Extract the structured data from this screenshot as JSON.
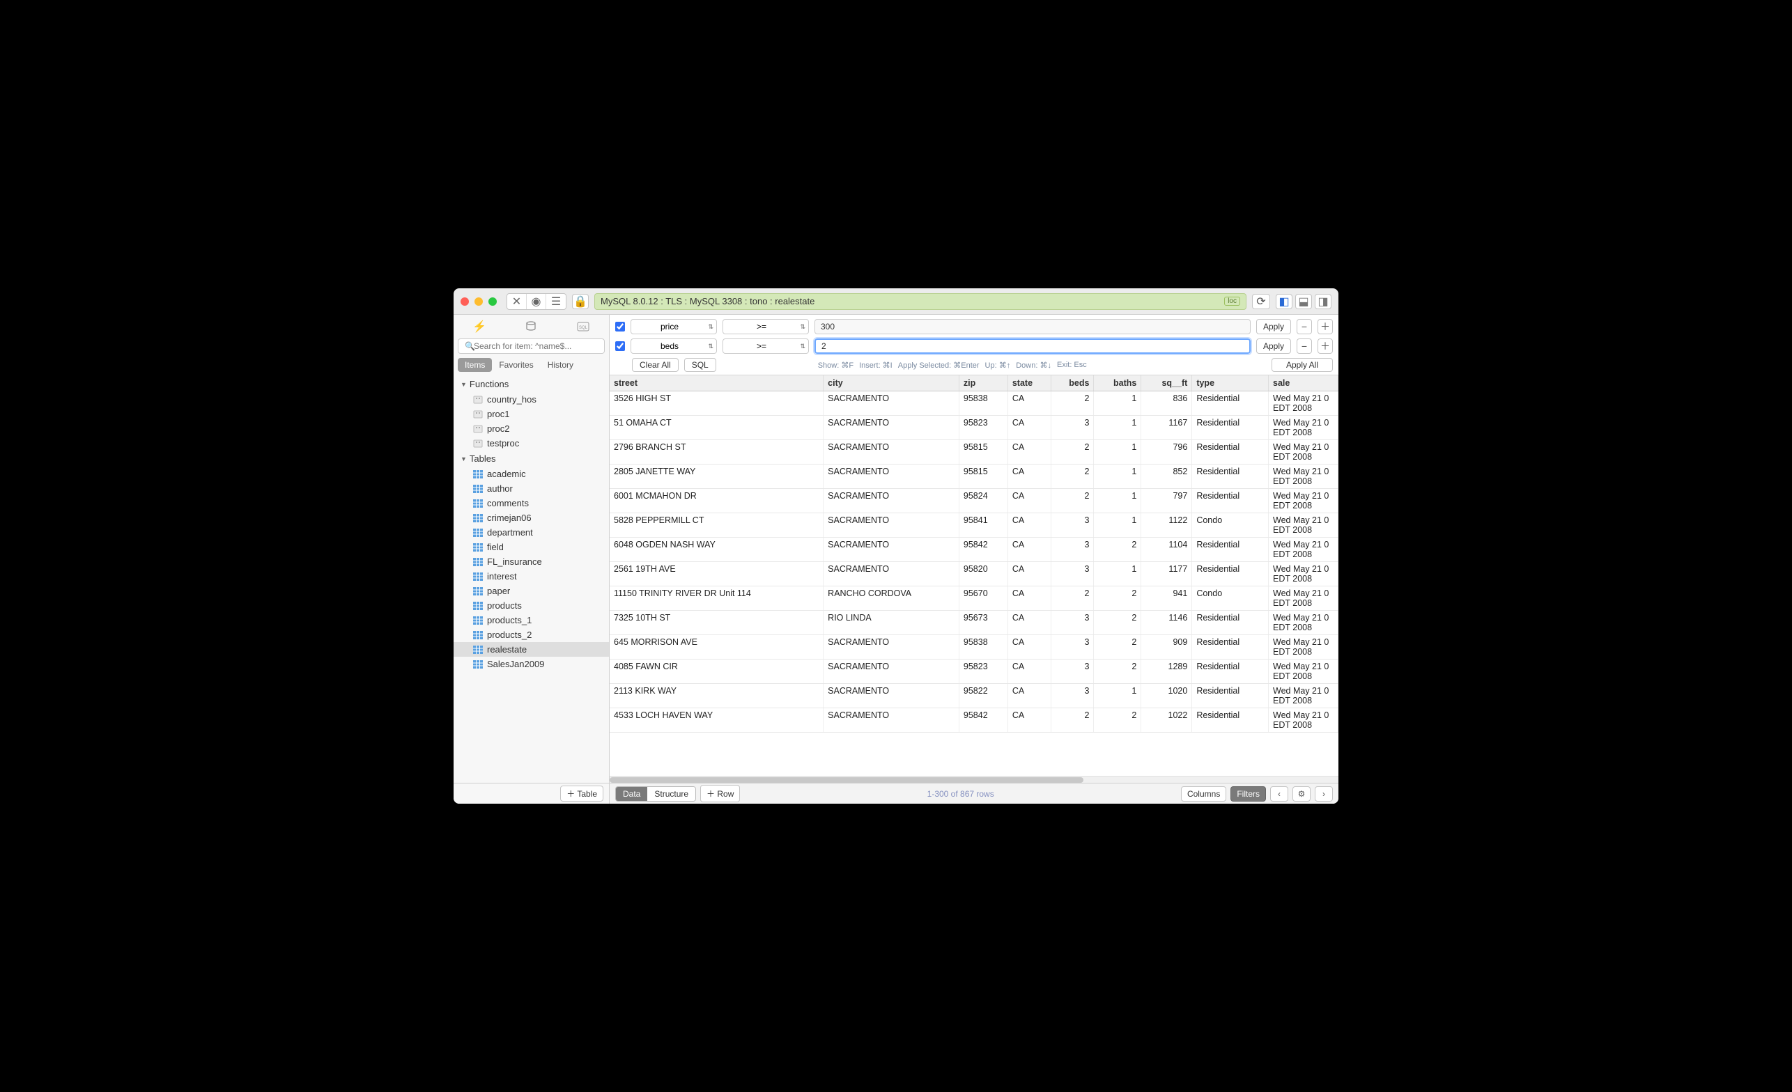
{
  "titlebar": {
    "connection": "MySQL 8.0.12 : TLS : MySQL 3308 : tono : realestate",
    "badge": "loc"
  },
  "sidebar": {
    "search_placeholder": "Search for item: ^name$...",
    "tabs": {
      "items": "Items",
      "favorites": "Favorites",
      "history": "History"
    },
    "groups": [
      {
        "label": "Functions",
        "kind": "proc",
        "items": [
          "country_hos",
          "proc1",
          "proc2",
          "testproc"
        ]
      },
      {
        "label": "Tables",
        "kind": "table",
        "items": [
          "academic",
          "author",
          "comments",
          "crimejan06",
          "department",
          "field",
          "FL_insurance",
          "interest",
          "paper",
          "products",
          "products_1",
          "products_2",
          "realestate",
          "SalesJan2009"
        ],
        "selected": "realestate"
      }
    ],
    "add_table": "Table"
  },
  "filters": {
    "rows": [
      {
        "enabled": true,
        "column": "price",
        "op": ">=",
        "value": "300",
        "focused": false
      },
      {
        "enabled": true,
        "column": "beds",
        "op": ">=",
        "value": "2",
        "focused": true
      }
    ],
    "apply": "Apply",
    "clear_all": "Clear All",
    "sql": "SQL",
    "hints": [
      "Show: ⌘F",
      "Insert: ⌘I",
      "Apply Selected: ⌘Enter",
      "Up: ⌘↑",
      "Down: ⌘↓",
      "Exit: Esc"
    ],
    "apply_all": "Apply All"
  },
  "table": {
    "columns": [
      "street",
      "city",
      "zip",
      "state",
      "beds",
      "baths",
      "sq__ft",
      "type",
      "sale"
    ],
    "numeric_cols": [
      "beds",
      "baths",
      "sq__ft"
    ],
    "rows": [
      {
        "street": "3526 HIGH ST",
        "city": "SACRAMENTO",
        "zip": "95838",
        "state": "CA",
        "beds": 2,
        "baths": 1,
        "sq__ft": 836,
        "type": "Residential",
        "sale": "Wed May 21 0 EDT 2008"
      },
      {
        "street": "51 OMAHA CT",
        "city": "SACRAMENTO",
        "zip": "95823",
        "state": "CA",
        "beds": 3,
        "baths": 1,
        "sq__ft": 1167,
        "type": "Residential",
        "sale": "Wed May 21 0 EDT 2008"
      },
      {
        "street": "2796 BRANCH ST",
        "city": "SACRAMENTO",
        "zip": "95815",
        "state": "CA",
        "beds": 2,
        "baths": 1,
        "sq__ft": 796,
        "type": "Residential",
        "sale": "Wed May 21 0 EDT 2008"
      },
      {
        "street": "2805 JANETTE WAY",
        "city": "SACRAMENTO",
        "zip": "95815",
        "state": "CA",
        "beds": 2,
        "baths": 1,
        "sq__ft": 852,
        "type": "Residential",
        "sale": "Wed May 21 0 EDT 2008"
      },
      {
        "street": "6001 MCMAHON DR",
        "city": "SACRAMENTO",
        "zip": "95824",
        "state": "CA",
        "beds": 2,
        "baths": 1,
        "sq__ft": 797,
        "type": "Residential",
        "sale": "Wed May 21 0 EDT 2008"
      },
      {
        "street": "5828 PEPPERMILL CT",
        "city": "SACRAMENTO",
        "zip": "95841",
        "state": "CA",
        "beds": 3,
        "baths": 1,
        "sq__ft": 1122,
        "type": "Condo",
        "sale": "Wed May 21 0 EDT 2008"
      },
      {
        "street": "6048 OGDEN NASH WAY",
        "city": "SACRAMENTO",
        "zip": "95842",
        "state": "CA",
        "beds": 3,
        "baths": 2,
        "sq__ft": 1104,
        "type": "Residential",
        "sale": "Wed May 21 0 EDT 2008"
      },
      {
        "street": "2561 19TH AVE",
        "city": "SACRAMENTO",
        "zip": "95820",
        "state": "CA",
        "beds": 3,
        "baths": 1,
        "sq__ft": 1177,
        "type": "Residential",
        "sale": "Wed May 21 0 EDT 2008"
      },
      {
        "street": "11150 TRINITY RIVER DR Unit 114",
        "city": "RANCHO CORDOVA",
        "zip": "95670",
        "state": "CA",
        "beds": 2,
        "baths": 2,
        "sq__ft": 941,
        "type": "Condo",
        "sale": "Wed May 21 0 EDT 2008"
      },
      {
        "street": "7325 10TH ST",
        "city": "RIO LINDA",
        "zip": "95673",
        "state": "CA",
        "beds": 3,
        "baths": 2,
        "sq__ft": 1146,
        "type": "Residential",
        "sale": "Wed May 21 0 EDT 2008"
      },
      {
        "street": "645 MORRISON AVE",
        "city": "SACRAMENTO",
        "zip": "95838",
        "state": "CA",
        "beds": 3,
        "baths": 2,
        "sq__ft": 909,
        "type": "Residential",
        "sale": "Wed May 21 0 EDT 2008"
      },
      {
        "street": "4085 FAWN CIR",
        "city": "SACRAMENTO",
        "zip": "95823",
        "state": "CA",
        "beds": 3,
        "baths": 2,
        "sq__ft": 1289,
        "type": "Residential",
        "sale": "Wed May 21 0 EDT 2008"
      },
      {
        "street": "2113 KIRK WAY",
        "city": "SACRAMENTO",
        "zip": "95822",
        "state": "CA",
        "beds": 3,
        "baths": 1,
        "sq__ft": 1020,
        "type": "Residential",
        "sale": "Wed May 21 0 EDT 2008"
      },
      {
        "street": "4533 LOCH HAVEN WAY",
        "city": "SACRAMENTO",
        "zip": "95842",
        "state": "CA",
        "beds": 2,
        "baths": 2,
        "sq__ft": 1022,
        "type": "Residential",
        "sale": "Wed May 21 0 EDT 2008"
      }
    ]
  },
  "footer": {
    "data": "Data",
    "structure": "Structure",
    "add_row": "Row",
    "rowcount": "1-300 of 867 rows",
    "columns": "Columns",
    "filters": "Filters"
  }
}
